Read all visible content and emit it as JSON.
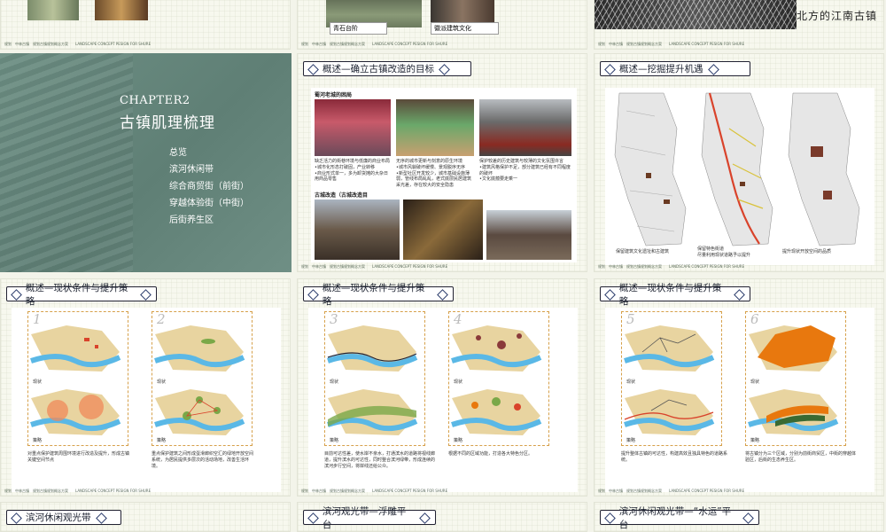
{
  "top_row": {
    "slide3_banner": "北方的江南古镇",
    "slide2_captions": [
      "青石台阶",
      "徽派建筑文化"
    ]
  },
  "footer_text": "规划　中林古镇　规划古镇规划概念方案　　LANDSCAPE CONCEPT PESIGN FOR SHURE",
  "chapter": {
    "label": "CHAPTER2",
    "title": "古镇肌理梳理",
    "items": [
      "总览",
      "滨河休闲带",
      "综合商贸街（前街）",
      "穿越体验街（中街）",
      "后街养生区"
    ]
  },
  "goal_slide": {
    "header": "概述—确立古镇改造的目标",
    "section1": "蜀河老城的困局",
    "captions": [
      "缺乏活力的街巷环境与低廉的商业布局\n•城市化形态打破固，产业转移\n•商业形式单一，多为卸货摊的大杂日用商品零售",
      "无序的城市更新与刻意的原生环境\n•城市风貌破坏缓慢、景观脱序无序\n•新型社区开发较少，城市基础设施薄弱，管线布局乱乱，老式底层民居建筑采光差，存在较大的安全隐患",
      "保护较差的历史建筑与较薄的文化氛围许言\n•建筑风格保护不足，部分建筑已经有不同程度的破坏\n•文化底蕴要走乘一"
    ],
    "section2": "古城改造（古城改造目"
  },
  "opp_slide": {
    "header": "概述—挖掘提升机遇",
    "captions": [
      "保留建筑文化遗址和古建筑",
      "保留特色街道\n尽量利用现状道路予以提升",
      "提升现状开放空间的品质"
    ]
  },
  "strategy": {
    "header": "概述—现状条件与提升策略",
    "label_now": "现状",
    "label_plan": "策略",
    "slides": [
      {
        "nums": [
          "1",
          "2"
        ],
        "captions": [
          "对重点保护建筑周围环境进行改造及提升，形成古镇关键空间节点",
          "重点保护建筑之间形成蛋滑廊织空汇的绿地开放空间系统，为居民提供多层次的活动场地，改善生活环境。"
        ]
      },
      {
        "nums": [
          "3",
          "4"
        ],
        "captions": [
          "目前可达性差，使水岸不亲水，打通滨水的道路将视线廊道，提升滨水的可达性，同时整合滨河绿带，形成连续的滨河步行空间，将岸线还给公众。",
          "根据不同的区域功能，打造各大特色分区。"
        ]
      },
      {
        "nums": [
          "5",
          "6"
        ],
        "captions": [
          "提升整体古镇的可达性，构建高效且独具特色的道路系统。",
          "将古镇分为三个区域，分别为前街商贸区，中街的穿越体验区，后街的生态养生区。"
        ]
      }
    ]
  },
  "bottom_row": {
    "headers": [
      "滨河休闲观光带",
      "滨河观光带—浮雕平台",
      "滨河休闲观光带—“水运”平台"
    ]
  },
  "colors": {
    "chapter_bg": "#678a7f",
    "river": "#5ab8e6",
    "land": "#e8d4a0",
    "accent_red": "#d9432b",
    "green_zone": "#7aa848",
    "orange_zone": "#e8780e"
  }
}
